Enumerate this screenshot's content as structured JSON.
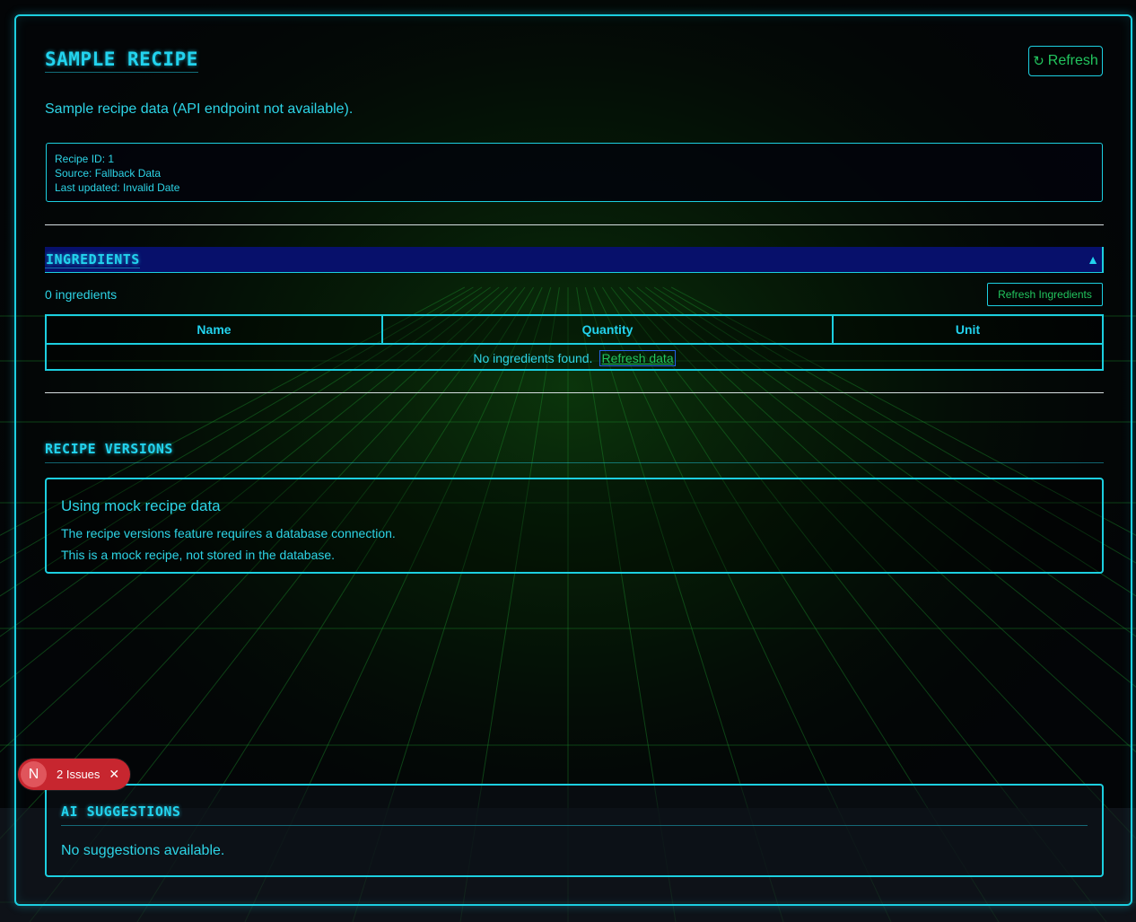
{
  "header": {
    "title": "SAMPLE RECIPE",
    "refresh_icon": "refresh-icon",
    "refresh_label": "Refresh"
  },
  "subtitle": "Sample recipe data (API endpoint not available).",
  "meta": {
    "recipe_id": "Recipe ID: 1",
    "source": "Source: Fallback Data",
    "last_updated": "Last updated: Invalid Date"
  },
  "ingredients": {
    "title": "INGREDIENTS",
    "toggle_icon": "caret-up-icon",
    "count": "0 ingredients",
    "refresh_label": "Refresh Ingredients",
    "columns": [
      "Name",
      "Quantity",
      "Unit"
    ],
    "empty_text": "No ingredients found.",
    "empty_link": "Refresh data"
  },
  "versions": {
    "title": "RECIPE VERSIONS",
    "heading": "Using mock recipe data",
    "line1": "The recipe versions feature requires a database connection.",
    "line2": "This is a mock recipe, not stored in the database."
  },
  "ai": {
    "title": "AI SUGGESTIONS",
    "empty": "No suggestions available."
  },
  "issues_badge": {
    "logo_letter": "N",
    "label": "2 Issues",
    "close_icon": "close-icon"
  },
  "colors": {
    "accent": "#22d3ee",
    "button_text": "#22c55e",
    "header_bg": "#07106b",
    "badge": "#c7262f"
  }
}
